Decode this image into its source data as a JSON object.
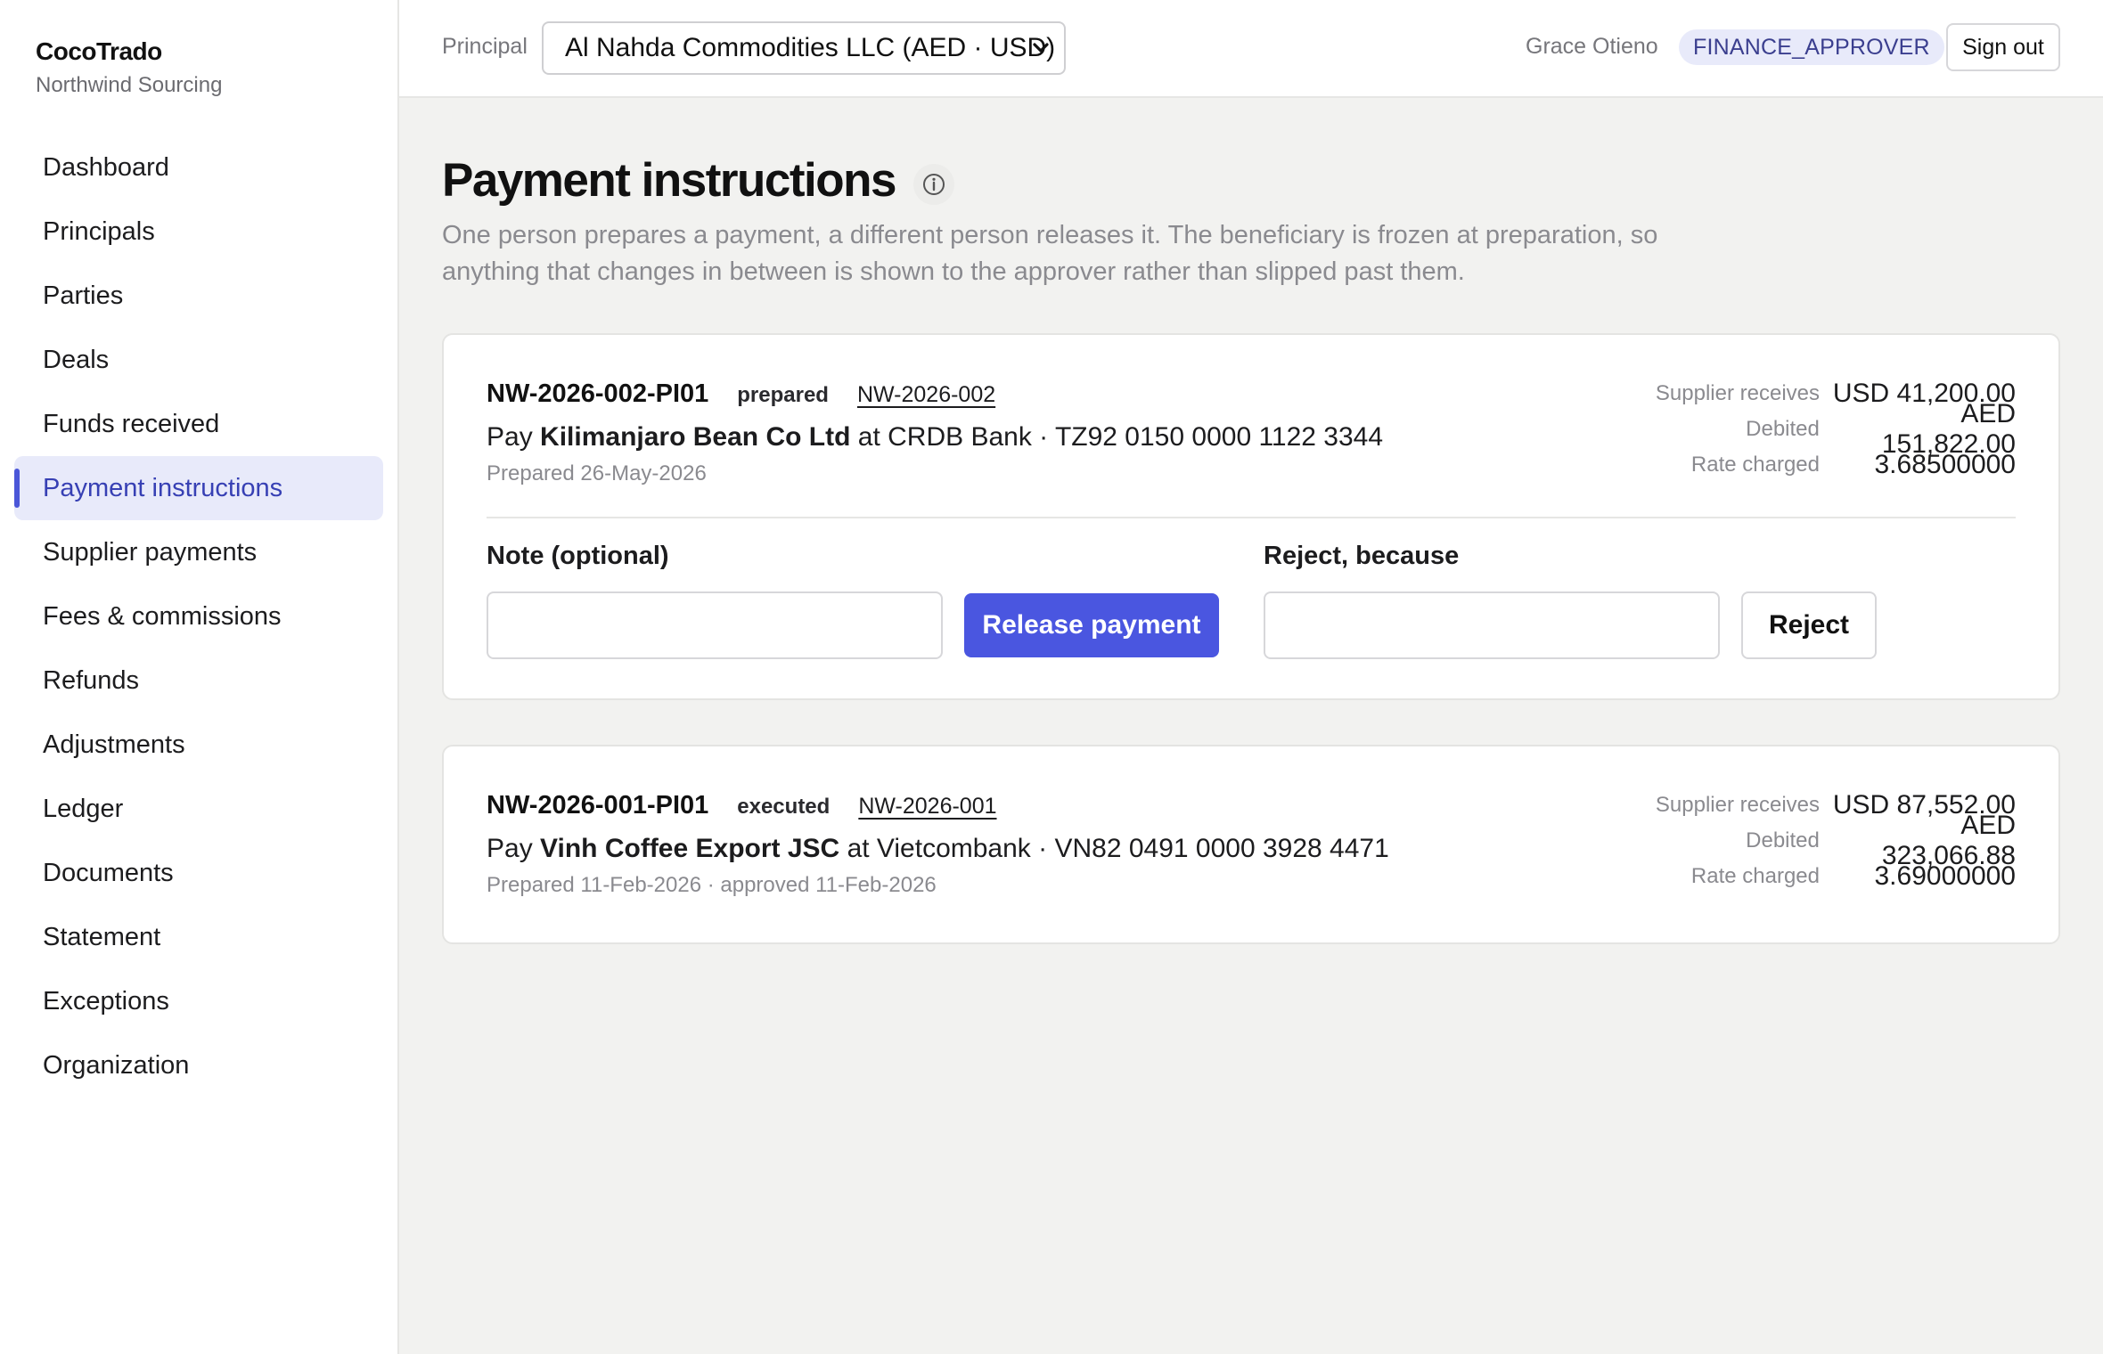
{
  "brand": {
    "name": "CocoTrado",
    "subtitle": "Northwind Sourcing"
  },
  "sidebar": {
    "items": [
      {
        "label": "Dashboard",
        "active": false
      },
      {
        "label": "Principals",
        "active": false
      },
      {
        "label": "Parties",
        "active": false
      },
      {
        "label": "Deals",
        "active": false
      },
      {
        "label": "Funds received",
        "active": false
      },
      {
        "label": "Payment instructions",
        "active": true
      },
      {
        "label": "Supplier payments",
        "active": false
      },
      {
        "label": "Fees & commissions",
        "active": false
      },
      {
        "label": "Refunds",
        "active": false
      },
      {
        "label": "Adjustments",
        "active": false
      },
      {
        "label": "Ledger",
        "active": false
      },
      {
        "label": "Documents",
        "active": false
      },
      {
        "label": "Statement",
        "active": false
      },
      {
        "label": "Exceptions",
        "active": false
      },
      {
        "label": "Organization",
        "active": false
      }
    ]
  },
  "topbar": {
    "principal_label": "Principal",
    "principal_value": "Al Nahda Commodities LLC (AED · USD)",
    "user_name": "Grace Otieno",
    "role": "FINANCE_APPROVER",
    "signout_label": "Sign out"
  },
  "page": {
    "title": "Payment instructions",
    "subtitle": "One person prepares a payment, a different person releases it. The beneficiary is frozen at preparation, so anything that changes in between is shown to the approver rather than slipped past them."
  },
  "instructions": [
    {
      "id": "NW-2026-002-PI01",
      "status": "prepared",
      "deal": "NW-2026-002",
      "pay_prefix": "Pay",
      "beneficiary": "Kilimanjaro Bean Co Ltd",
      "bank_details": "at CRDB Bank · TZ92 0150 0000 1122 3344",
      "meta": "Prepared 26-May-2026",
      "supplier_receives_label": "Supplier receives",
      "supplier_receives": "USD 41,200.00",
      "debited_label": "Debited",
      "debited": "AED 151,822.00",
      "rate_label": "Rate charged",
      "rate": "3.68500000"
    },
    {
      "id": "NW-2026-001-PI01",
      "status": "executed",
      "deal": "NW-2026-001",
      "pay_prefix": "Pay",
      "beneficiary": "Vinh Coffee Export JSC",
      "bank_details": "at Vietcombank · VN82 0491 0000 3928 4471",
      "meta": "Prepared 11-Feb-2026 · approved 11-Feb-2026",
      "supplier_receives_label": "Supplier receives",
      "supplier_receives": "USD 87,552.00",
      "debited_label": "Debited",
      "debited": "AED 323,066.88",
      "rate_label": "Rate charged",
      "rate": "3.69000000"
    }
  ],
  "actions": {
    "note_label": "Note (optional)",
    "note_value": "",
    "release_label": "Release payment",
    "reject_reason_label": "Reject, because",
    "reject_reason_value": "",
    "reject_label": "Reject"
  },
  "colors": {
    "accent": "#4a56e0",
    "active_bg": "#e8eafa",
    "page_bg": "#f2f2f0"
  },
  "icons": {
    "info": "info-circle-icon",
    "select": "chevron-down-icon"
  }
}
